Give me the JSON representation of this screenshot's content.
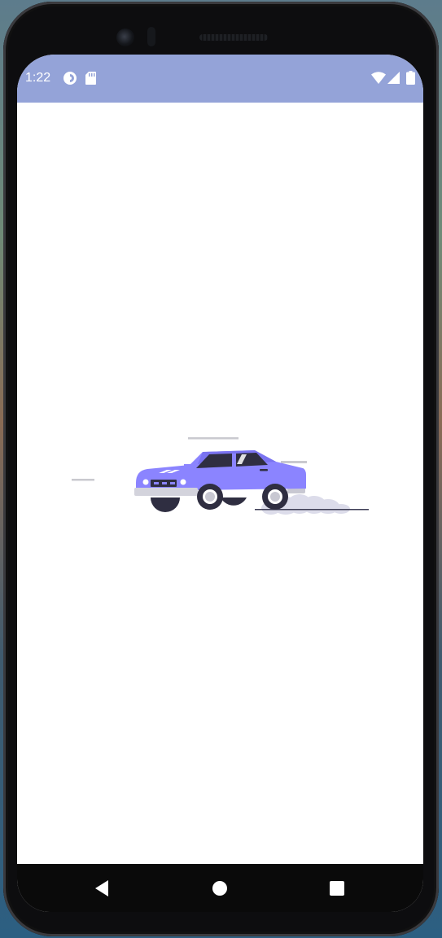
{
  "status_bar": {
    "time": "1:22",
    "background_color": "#94a3d8",
    "left_icons": [
      "data-saver-icon",
      "sd-card-icon"
    ],
    "right_icons": [
      "wifi-icon",
      "cellular-signal-icon",
      "battery-icon"
    ]
  },
  "main": {
    "background_color": "#ffffff",
    "illustration": {
      "name": "car-illustration",
      "car_color": "#8b84ff",
      "smoke_color": "#dcdcea"
    }
  },
  "navigation_bar": {
    "buttons": [
      "back-icon",
      "home-icon",
      "recents-icon"
    ],
    "background_color": "#0a0a0a"
  }
}
